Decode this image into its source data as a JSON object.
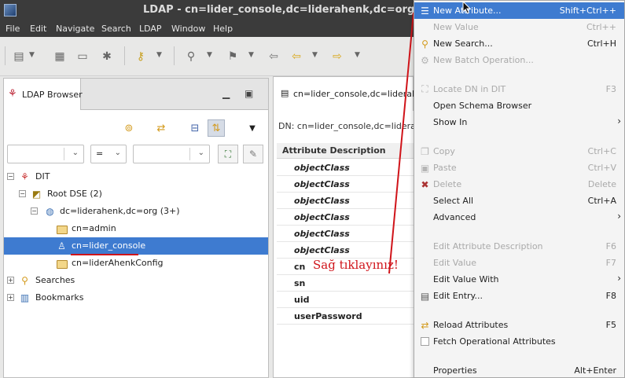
{
  "window": {
    "title": "LDAP - cn=lider_console,dc=liderahenk,dc=org - L"
  },
  "menubar": [
    "File",
    "Edit",
    "Navigate",
    "Search",
    "LDAP",
    "Window",
    "Help"
  ],
  "toolbar": {
    "icons": [
      "new-entry-icon",
      "save-icon",
      "print-icon",
      "settings-icon",
      "connect-icon",
      "search-icon",
      "bookmark-icon",
      "back-icon",
      "previous-icon",
      "next-icon",
      "forward-icon"
    ]
  },
  "ldap_browser": {
    "tab_label": "LDAP Browser",
    "filter_operator": "=",
    "tree": [
      {
        "label": "DIT",
        "level": 0,
        "expander": "−",
        "icon": "dit-icon"
      },
      {
        "label": "Root DSE (2)",
        "level": 1,
        "expander": "−",
        "icon": "root-dse-icon"
      },
      {
        "label": "dc=liderahenk,dc=org (3+)",
        "level": 2,
        "expander": "−",
        "icon": "domain-icon"
      },
      {
        "label": "cn=admin",
        "level": 3,
        "expander": "",
        "icon": "folder-icon"
      },
      {
        "label": "cn=lider_console",
        "level": 3,
        "expander": "",
        "icon": "person-icon",
        "selected": true
      },
      {
        "label": "cn=liderAhenkConfig",
        "level": 3,
        "expander": "",
        "icon": "folder-icon"
      },
      {
        "label": "Searches",
        "level": 0,
        "expander": "+",
        "icon": "searches-icon"
      },
      {
        "label": "Bookmarks",
        "level": 0,
        "expander": "+",
        "icon": "bookmarks-icon"
      }
    ]
  },
  "entry_editor": {
    "tab_label": "cn=lider_console,dc=liderahe",
    "dn_label": "DN: cn=lider_console,dc=liderah",
    "column_header": "Attribute Description",
    "attributes": [
      {
        "name": "objectClass",
        "italic": true
      },
      {
        "name": "objectClass",
        "italic": true
      },
      {
        "name": "objectClass",
        "italic": true
      },
      {
        "name": "objectClass",
        "italic": true
      },
      {
        "name": "objectClass",
        "italic": true
      },
      {
        "name": "objectClass",
        "italic": true
      },
      {
        "name": "cn",
        "italic": false
      },
      {
        "name": "sn",
        "italic": false
      },
      {
        "name": "uid",
        "italic": false
      },
      {
        "name": "userPassword",
        "italic": false
      }
    ]
  },
  "annotation": {
    "text": "Sağ tıklayınız!",
    "color": "#d0141a"
  },
  "context_menu": {
    "items": [
      {
        "label": "New Attribute...",
        "accel": "Shift+Ctrl++",
        "icon": "new-attribute-icon",
        "highlighted": true,
        "disabled": false
      },
      {
        "label": "New Value",
        "accel": "Ctrl++",
        "icon": "",
        "disabled": true
      },
      {
        "label": "New Search...",
        "accel": "Ctrl+H",
        "icon": "new-search-icon",
        "disabled": false
      },
      {
        "label": "New Batch Operation...",
        "accel": "",
        "icon": "batch-operation-icon",
        "disabled": true
      },
      {
        "separator": true
      },
      {
        "label": "Locate DN in DIT",
        "accel": "F3",
        "icon": "locate-dn-icon",
        "disabled": true
      },
      {
        "label": "Open Schema Browser",
        "accel": "",
        "icon": "",
        "disabled": false
      },
      {
        "label": "Show In",
        "accel": "",
        "icon": "",
        "disabled": false,
        "submenu": true
      },
      {
        "separator": true
      },
      {
        "label": "Copy",
        "accel": "Ctrl+C",
        "icon": "copy-icon",
        "disabled": true
      },
      {
        "label": "Paste",
        "accel": "Ctrl+V",
        "icon": "paste-icon",
        "disabled": true
      },
      {
        "label": "Delete",
        "accel": "Delete",
        "icon": "delete-icon",
        "disabled": true
      },
      {
        "label": "Select All",
        "accel": "Ctrl+A",
        "icon": "",
        "disabled": false
      },
      {
        "label": "Advanced",
        "accel": "",
        "icon": "",
        "disabled": false,
        "submenu": true
      },
      {
        "separator": true
      },
      {
        "label": "Edit Attribute Description",
        "accel": "F6",
        "icon": "",
        "disabled": true
      },
      {
        "label": "Edit Value",
        "accel": "F7",
        "icon": "",
        "disabled": true
      },
      {
        "label": "Edit Value With",
        "accel": "",
        "icon": "",
        "disabled": false,
        "submenu": true
      },
      {
        "label": "Edit Entry...",
        "accel": "F8",
        "icon": "edit-entry-icon",
        "disabled": false
      },
      {
        "separator": true
      },
      {
        "label": "Reload Attributes",
        "accel": "F5",
        "icon": "reload-icon",
        "disabled": false
      },
      {
        "label": "Fetch Operational Attributes",
        "accel": "",
        "icon": "checkbox-icon",
        "disabled": false
      },
      {
        "separator": true
      },
      {
        "label": "Properties",
        "accel": "Alt+Enter",
        "icon": "",
        "disabled": false
      }
    ]
  }
}
